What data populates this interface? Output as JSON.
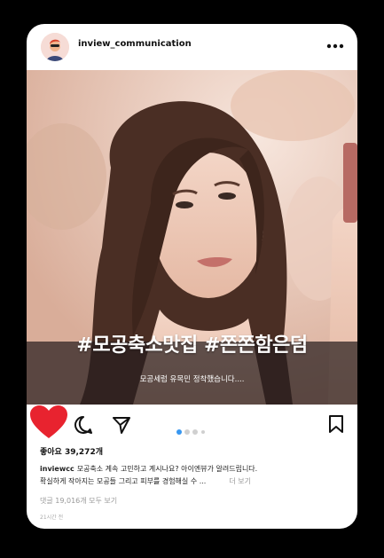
{
  "post": {
    "username": "inview_communication",
    "hashtags": "#모공축소맛집 #쫀쫀함은덤",
    "subcaption": "모공세럼 유목민 정착했습니다....",
    "likes": "좋아요 39,272개",
    "caption_user": "inviewcc",
    "caption_line1": "모공축소 계속 고민하고 계시나요? 아이엔뷰가 알려드립니다.",
    "caption_line2": "확실하게 작아지는 모공들 그리고 피부를 경험해실 수 ...",
    "more_label": "더 보기",
    "comments_link": "댓글 19,016개 모두 보기",
    "time": "21시간 전"
  },
  "carousel": {
    "count": 4,
    "active": 0
  },
  "icons": [
    "avatar",
    "more-icon",
    "heart-icon",
    "comment-icon",
    "share-icon",
    "bookmark-icon"
  ],
  "colors": {
    "heart": "#e8232f",
    "active_dot": "#3897f0"
  }
}
